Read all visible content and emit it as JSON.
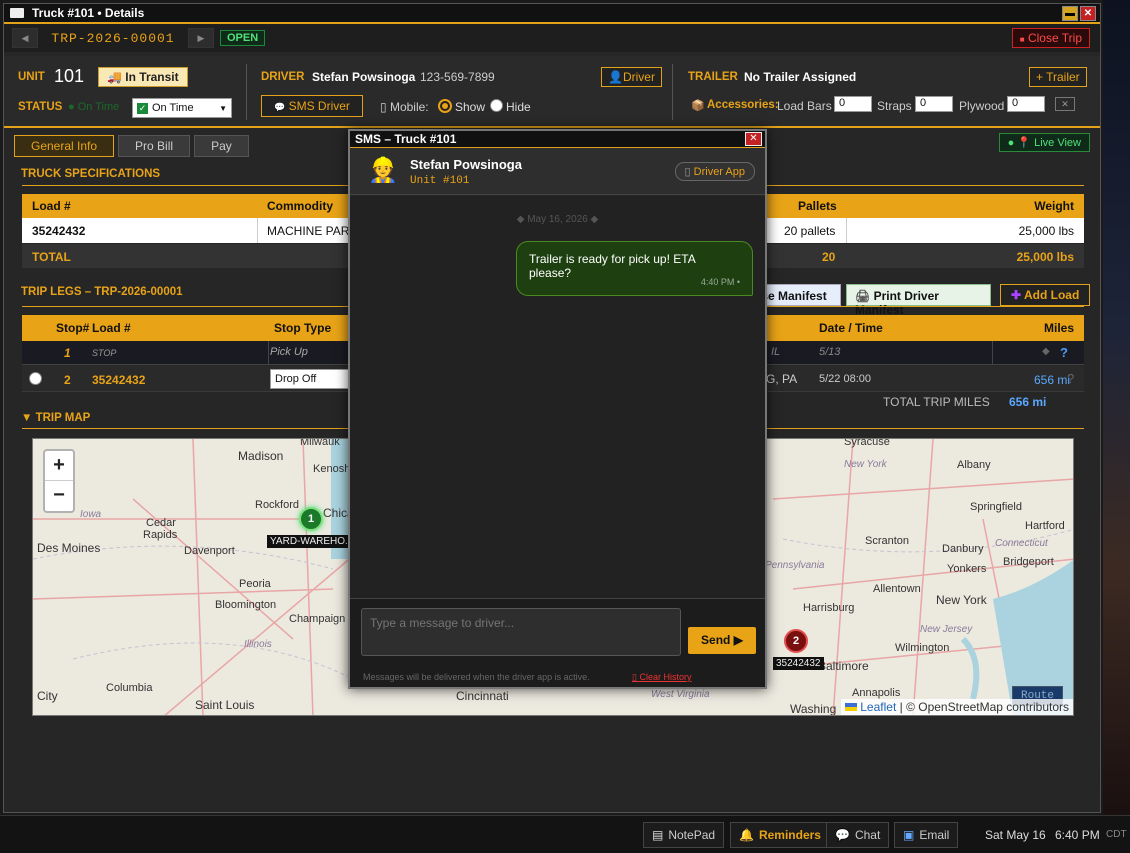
{
  "window": {
    "title": "Truck #101 • Details"
  },
  "trip": {
    "id": "TRP-2026-00001",
    "state": "OPEN",
    "close_label": "Close Trip"
  },
  "unit": {
    "label": "UNIT",
    "number": "101",
    "transit": "In Transit"
  },
  "status": {
    "label": "STATUS",
    "hidden_text": "On Time",
    "value": "On Time"
  },
  "driver": {
    "label": "DRIVER",
    "name": "Stefan Powsinoga",
    "phone": "123-569-7899",
    "btn": "Driver",
    "sms_btn": "SMS Driver",
    "mobile_label": "Mobile:",
    "show": "Show",
    "hide": "Hide"
  },
  "trailer": {
    "label": "TRAILER",
    "value": "No Trailer Assigned",
    "btn": "+ Trailer"
  },
  "accessories": {
    "label": "Accessories:",
    "load_bars": "Load Bars",
    "load_bars_val": "0",
    "straps": "Straps",
    "straps_val": "0",
    "plywood": "Plywood",
    "plywood_val": "0"
  },
  "tabs": [
    "General Info",
    "Pro Bill",
    "Pay"
  ],
  "live_view": "Live View",
  "specs": {
    "title": "TRUCK SPECIFICATIONS",
    "headers": {
      "load": "Load #",
      "commodity": "Commodity",
      "pallets": "Pallets",
      "weight": "Weight"
    },
    "row": {
      "load": "35242432",
      "commodity": "MACHINE PAR",
      "pallets": "20 pallets",
      "weight": "25,000 lbs"
    },
    "total": {
      "label": "TOTAL",
      "pallets": "20",
      "weight": "25,000 lbs"
    }
  },
  "legs": {
    "title": "TRIP LEGS – TRP-2026-00001",
    "btn_manifest_cut": "use Manifest",
    "btn_print": "Print Driver Manifest",
    "btn_add": "Add Load",
    "headers": {
      "stop": "Stop#",
      "load": "Load #",
      "type": "Stop Type",
      "date": "Date / Time",
      "miles": "Miles"
    },
    "rows": [
      {
        "stop": "1",
        "load": "STOP",
        "type": "Pick Up",
        "loc": "IL",
        "date": "5/13",
        "miles": "",
        "q": "?"
      },
      {
        "stop": "2",
        "load": "35242432",
        "type": "Drop Off",
        "loc": "G, PA",
        "date": "5/22 08:00",
        "miles": "656 mi",
        "q": "?"
      }
    ],
    "total_label": "TOTAL TRIP MILES",
    "total_value": "656 mi"
  },
  "map": {
    "title": "▼ TRIP MAP",
    "cities": [
      "Milwauk",
      "Madison",
      "Kenosh",
      "Rockford",
      "Chica",
      "Cedar",
      "Rapids",
      "Des Moines",
      "Davenport",
      "Peoria",
      "Bloomington",
      "Champaign",
      "Columbia",
      "Saint Louis",
      "City",
      "Cincinnati",
      "Syracuse",
      "Albany",
      "Springfield",
      "Hartford",
      "Scranton",
      "Danbury",
      "Bridgeport",
      "Yonkers",
      "Allentown",
      "New York",
      "Harrisburg",
      "Wilmington",
      "Baltimore",
      "Annapolis",
      "Washing"
    ],
    "states": [
      "Iowa",
      "Illinois",
      "New York",
      "Connecticut",
      "Pennsylvania",
      "New Jersey",
      "West Virginia"
    ],
    "marker1": "1",
    "marker1_label": "YARD-WAREHO...",
    "marker2": "2",
    "marker2_label": "35242432",
    "route_btn": "Route",
    "attribution_leaflet": "Leaflet",
    "attribution_rest": "| © OpenStreetMap contributors"
  },
  "sms": {
    "title": "SMS – Truck #101",
    "name": "Stefan Powsinoga",
    "unit": "Unit #101",
    "app_btn": "Driver App",
    "date": "◆ May 16, 2026 ◆",
    "message": "Trailer is ready for pick up! ETA please?",
    "time": "4:40 PM •",
    "placeholder": "Type a message to driver...",
    "send": "Send ▶",
    "note": "Messages will be delivered when the driver app is active.",
    "clear": "Clear History"
  },
  "taskbar": {
    "notepad": "NotePad",
    "reminders": "Reminders",
    "chat": "Chat",
    "email": "Email",
    "date": "Sat May 16",
    "time": "6:40 PM",
    "tz": "CDT"
  }
}
